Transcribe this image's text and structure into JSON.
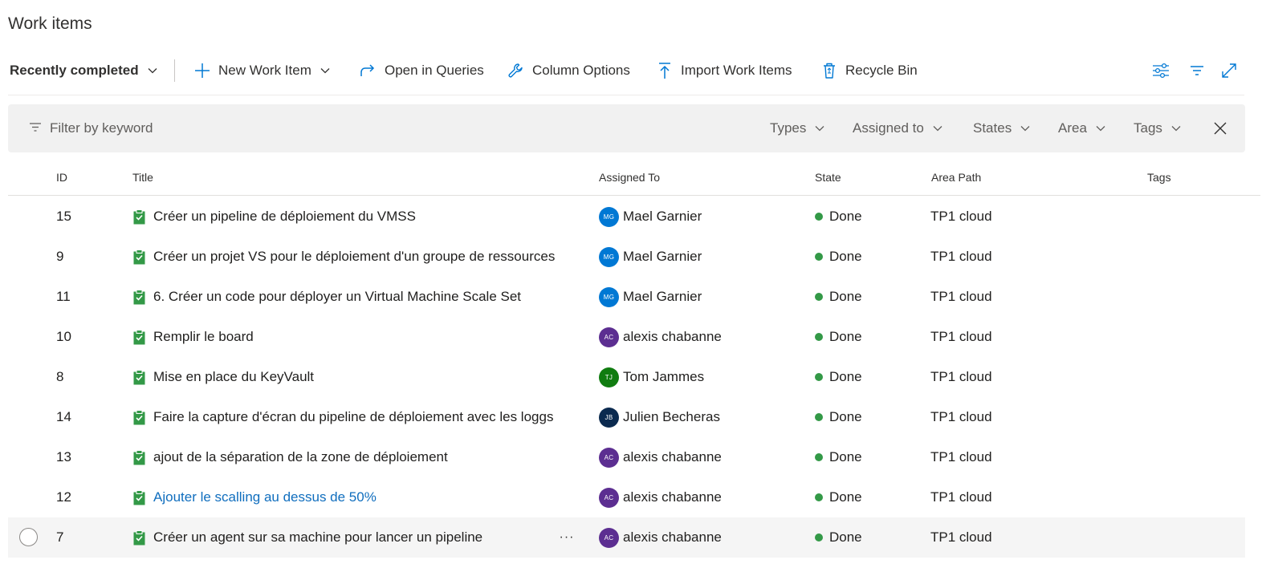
{
  "page": {
    "title": "Work items"
  },
  "toolbar": {
    "view_selector": "Recently completed",
    "new_work_item": "New Work Item",
    "open_in_queries": "Open in Queries",
    "column_options": "Column Options",
    "import_work_items": "Import Work Items",
    "recycle_bin": "Recycle Bin",
    "right_icons": [
      "view-options-icon",
      "filter-icon",
      "expand-icon"
    ]
  },
  "filter": {
    "placeholder": "Filter by keyword",
    "dropdowns": [
      "Types",
      "Assigned to",
      "States",
      "Area",
      "Tags"
    ]
  },
  "columns": [
    "ID",
    "Title",
    "Assigned To",
    "State",
    "Area Path",
    "Tags"
  ],
  "colors": {
    "accent": "#0078d4",
    "done_state": "#339947",
    "task_icon": "#339947",
    "link": "#106ebe",
    "avatar_mg": "#0078d4",
    "avatar_ac": "#5c2e91",
    "avatar_tj": "#107c10",
    "avatar_jb": "#0b2a4f"
  },
  "rows": [
    {
      "id": "15",
      "title": "Créer un pipeline de déploiement du VMSS",
      "assigned_initials": "MG",
      "assigned": "Mael Garnier",
      "avatar_color": "#0078d4",
      "state": "Done",
      "area": "TP1 cloud",
      "tags": ""
    },
    {
      "id": "9",
      "title": "Créer un projet VS pour le déploiement d'un groupe de ressources",
      "assigned_initials": "MG",
      "assigned": "Mael Garnier",
      "avatar_color": "#0078d4",
      "state": "Done",
      "area": "TP1 cloud",
      "tags": ""
    },
    {
      "id": "11",
      "title": "6. Créer un code pour déployer un Virtual Machine Scale Set",
      "assigned_initials": "MG",
      "assigned": "Mael Garnier",
      "avatar_color": "#0078d4",
      "state": "Done",
      "area": "TP1 cloud",
      "tags": ""
    },
    {
      "id": "10",
      "title": "Remplir le board",
      "assigned_initials": "AC",
      "assigned": "alexis chabanne",
      "avatar_color": "#5c2e91",
      "state": "Done",
      "area": "TP1 cloud",
      "tags": ""
    },
    {
      "id": "8",
      "title": "Mise en place du KeyVault",
      "assigned_initials": "TJ",
      "assigned": "Tom Jammes",
      "avatar_color": "#107c10",
      "state": "Done",
      "area": "TP1 cloud",
      "tags": ""
    },
    {
      "id": "14",
      "title": "Faire la capture d'écran du pipeline de déploiement avec les loggs",
      "assigned_initials": "JB",
      "assigned": "Julien Becheras",
      "avatar_color": "#0b2a4f",
      "state": "Done",
      "area": "TP1 cloud",
      "tags": ""
    },
    {
      "id": "13",
      "title": "ajout de la séparation de la zone de déploiement",
      "assigned_initials": "AC",
      "assigned": "alexis chabanne",
      "avatar_color": "#5c2e91",
      "state": "Done",
      "area": "TP1 cloud",
      "tags": ""
    },
    {
      "id": "12",
      "title": "Ajouter le scalling au dessus de 50%",
      "assigned_initials": "AC",
      "assigned": "alexis chabanne",
      "avatar_color": "#5c2e91",
      "state": "Done",
      "area": "TP1 cloud",
      "tags": ""
    },
    {
      "id": "7",
      "title": "Créer un agent sur sa machine pour lancer un pipeline",
      "assigned_initials": "AC",
      "assigned": "alexis chabanne",
      "avatar_color": "#5c2e91",
      "state": "Done",
      "area": "TP1 cloud",
      "tags": ""
    }
  ],
  "row_more_label": "···"
}
